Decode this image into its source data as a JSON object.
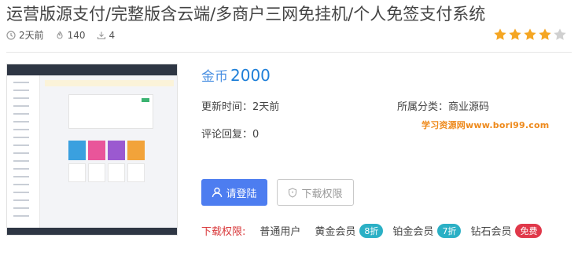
{
  "title": "运营版源支付/完整版含云端/多商户三网免挂机/个人免签支付系统",
  "meta": {
    "time": "2天前",
    "views": "140",
    "downloads": "4"
  },
  "rating": {
    "value": 4,
    "max": 5,
    "color_on": "#f5a623",
    "color_off": "#d0d0d0"
  },
  "price": {
    "label": "金币",
    "value": "2000"
  },
  "info": {
    "updated_label": "更新时间：",
    "updated_value": "2天前",
    "category_label": "所属分类：",
    "category_value": "商业源码",
    "comments_label": "评论回复：",
    "comments_value": "0"
  },
  "watermark": "学习资源网www.bori99.com",
  "buttons": {
    "login": "请登陆",
    "download": "下载权限"
  },
  "permissions": {
    "label": "下载权限:",
    "tiers": [
      {
        "name": "普通用户",
        "badge": ""
      },
      {
        "name": "黄金会员",
        "badge": "8折",
        "color": "#2bb0c5"
      },
      {
        "name": "铂金会员",
        "badge": "7折",
        "color": "#2bb0c5"
      },
      {
        "name": "钻石会员",
        "badge": "免费",
        "color": "#e0384a"
      }
    ]
  },
  "icons": {
    "time": "clock-icon",
    "views": "flame-icon",
    "downloads": "download-icon",
    "login": "user-icon",
    "download": "shield-icon"
  }
}
